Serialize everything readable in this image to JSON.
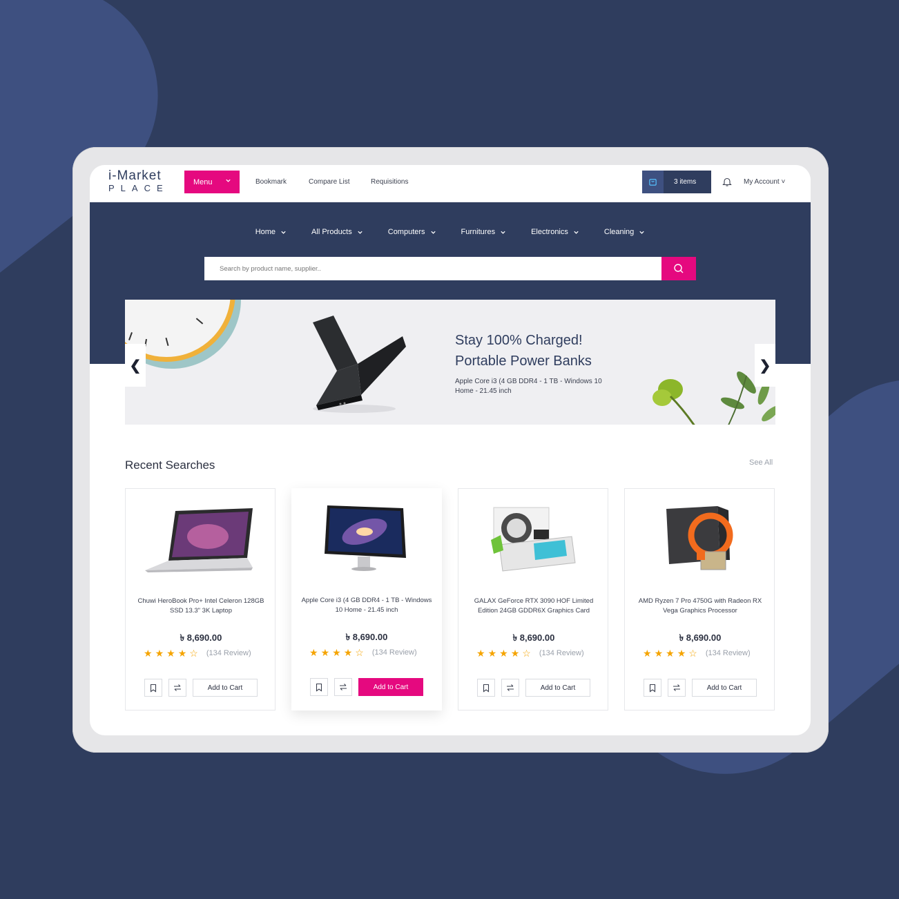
{
  "brand": {
    "logo_main": "i-Market",
    "logo_sub": "PLACE"
  },
  "header": {
    "menu_label": "Menu",
    "links": [
      "Bookmark",
      "Compare List",
      "Requisitions"
    ],
    "cart_label": "3 items",
    "account_label": "My Account ˅"
  },
  "nav": [
    "Home",
    "All Products",
    "Computers",
    "Furnitures",
    "Electronics",
    "Cleaning"
  ],
  "search": {
    "placeholder": "Search by product name, supplier.."
  },
  "banner": {
    "title_line1": "Stay 100% Charged!",
    "title_line2": "Portable Power Banks",
    "description": "Apple Core i3 (4 GB DDR4 - 1 TB - Windows 10 Home - 21.45 inch",
    "prev": "❮",
    "next": "❯"
  },
  "recent": {
    "title": "Recent Searches",
    "see_all": "See All",
    "products": [
      {
        "name": "Chuwi HeroBook Pro+ Intel Celeron 128GB SSD 13.3\" 3K Laptop",
        "price": "৳ 8,690.00",
        "rating": 4,
        "reviews": "(134 Review)",
        "cart_label": "Add to Cart"
      },
      {
        "name": "Apple Core i3 (4 GB DDR4 - 1 TB - Windows 10 Home - 21.45 inch",
        "price": "৳ 8,690.00",
        "rating": 4,
        "reviews": "(134 Review)",
        "cart_label": "Add to Cart"
      },
      {
        "name": "GALAX GeForce RTX 3090 HOF Limited Edition 24GB GDDR6X Graphics Card",
        "price": "৳ 8,690.00",
        "rating": 4,
        "reviews": "(134 Review)",
        "cart_label": "Add to Cart"
      },
      {
        "name": "AMD Ryzen 7 Pro 4750G with Radeon RX Vega Graphics Processor",
        "price": "৳ 8,690.00",
        "rating": 4,
        "reviews": "(134 Review)",
        "cart_label": "Add to Cart"
      }
    ]
  },
  "colors": {
    "navy": "#2f3d5e",
    "accent": "#e5097f",
    "star": "#f5a400"
  }
}
